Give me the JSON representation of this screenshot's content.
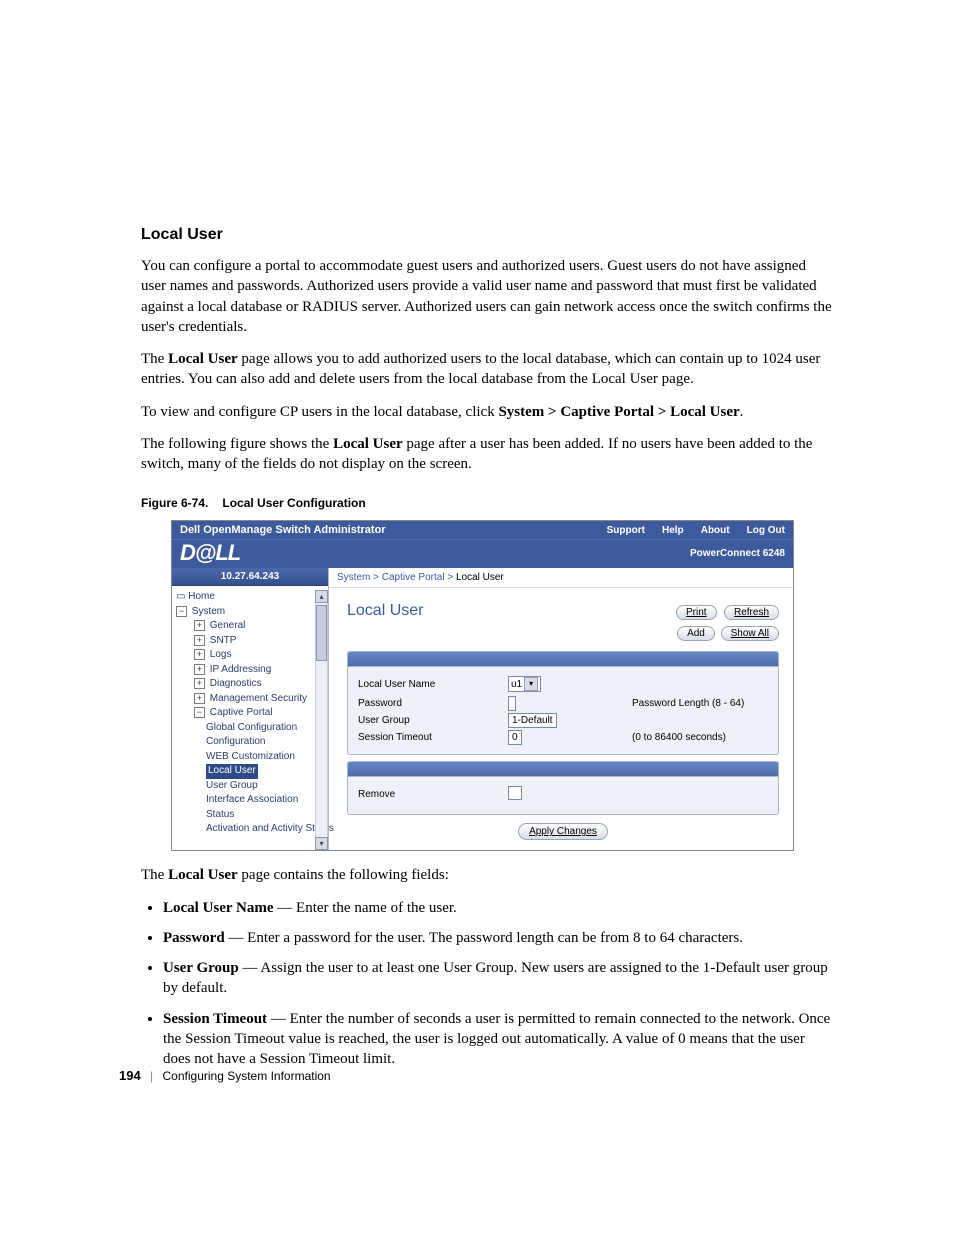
{
  "heading": "Local User",
  "para1": "You can configure a portal to accommodate guest users and authorized users. Guest users do not have assigned user names and passwords. Authorized users provide a valid user name and password that must first be validated against a local database or RADIUS server. Authorized users can gain network access once the switch confirms the user's credentials.",
  "para2_a": "The ",
  "para2_b": "Local User",
  "para2_c": " page allows you to add authorized users to the local database, which can contain up to 1024 user entries. You can also add and delete users from the local database from the Local User page.",
  "para3_a": "To view and configure CP users in the local database, click ",
  "para3_b": "System > Captive Portal > Local User",
  "para3_c": ".",
  "para4_a": "The following figure shows the ",
  "para4_b": "Local User",
  "para4_c": " page after a user has been added. If no users have been added to the switch, many of the fields do not display on the screen.",
  "fig_label": "Figure 6-74.",
  "fig_title": "Local User Configuration",
  "shot": {
    "titlebar": "Dell OpenManage Switch Administrator",
    "toplinks": [
      "Support",
      "Help",
      "About",
      "Log Out"
    ],
    "logo": "D@LL",
    "model": "PowerConnect 6248",
    "ip": "10.27.64.243",
    "breadcrumb_pre": "System > Captive Portal > ",
    "breadcrumb_cur": "Local User",
    "nav": {
      "home": "Home",
      "system": "System",
      "general": "General",
      "sntp": "SNTP",
      "logs": "Logs",
      "ipaddr": "IP Addressing",
      "diag": "Diagnostics",
      "mgmt": "Management Security",
      "cp": "Captive Portal",
      "cp_global": "Global Configuration",
      "cp_conf": "Configuration",
      "cp_web": "WEB Customization",
      "cp_local": "Local User",
      "cp_group": "User Group",
      "cp_assoc": "Interface Association",
      "cp_status": "Status",
      "cp_act": "Activation and Activity Status"
    },
    "page_title": "Local User",
    "btn_print": "Print",
    "btn_refresh": "Refresh",
    "btn_add": "Add",
    "btn_showall": "Show All",
    "form": {
      "l_name": "Local User Name",
      "v_name": "u1",
      "l_pass": "Password",
      "hint_pass": "Password Length (8 - 64)",
      "l_group": "User Group",
      "v_group": "1-Default",
      "l_timeout": "Session Timeout",
      "v_timeout": "0",
      "hint_timeout": "(0 to 86400 seconds)",
      "l_remove": "Remove"
    },
    "apply": "Apply Changes"
  },
  "after_intro_a": "The ",
  "after_intro_b": "Local User",
  "after_intro_c": " page contains the following fields:",
  "fields": [
    {
      "lead": "Local User Name",
      "text": " — Enter the name of the user."
    },
    {
      "lead": "Password",
      "text": " — Enter a password for the user. The password length can be from 8 to 64 characters."
    },
    {
      "lead": "User Group",
      "text": " — Assign the user to at least one User Group. New users are assigned to the 1-Default user group by default."
    },
    {
      "lead": "Session Timeout",
      "text": " — Enter the number of seconds a user is permitted to remain connected to the network. Once the Session Timeout value is reached, the user is logged out automatically. A value of 0 means that the user does not have a Session Timeout limit."
    }
  ],
  "footer_page": "194",
  "footer_sep": "|",
  "footer_chap": "Configuring System Information"
}
